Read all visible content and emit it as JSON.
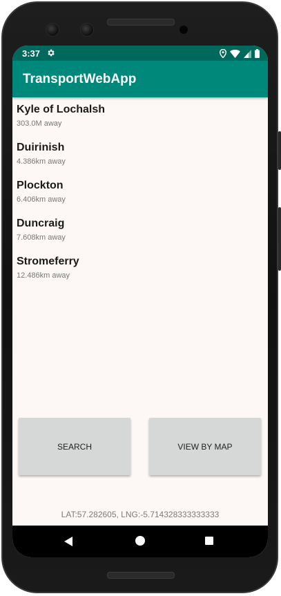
{
  "status_bar": {
    "time": "3:37",
    "icons": [
      "gear-icon",
      "location-icon",
      "wifi-icon",
      "cell-signal-icon",
      "battery-icon"
    ]
  },
  "app_bar": {
    "title": "TransportWebApp"
  },
  "stations": [
    {
      "name": "Kyle of Lochalsh",
      "distance": "303.0M away"
    },
    {
      "name": "Duirinish",
      "distance": "4.386km away"
    },
    {
      "name": "Plockton",
      "distance": "6.406km away"
    },
    {
      "name": "Duncraig",
      "distance": "7.608km away"
    },
    {
      "name": "Stromeferry",
      "distance": "12.486km away"
    }
  ],
  "buttons": {
    "search_label": "SEARCH",
    "map_label": "VIEW BY MAP"
  },
  "location_readout": "LAT:57.282605, LNG:-5.714328333333333",
  "nav_bar": {
    "icons": [
      "back-icon",
      "home-icon",
      "recents-icon"
    ]
  },
  "colors": {
    "status_bar": "#00695c",
    "app_bar": "#00897b",
    "background": "#fdf8f6",
    "button": "#d6d7d7"
  }
}
